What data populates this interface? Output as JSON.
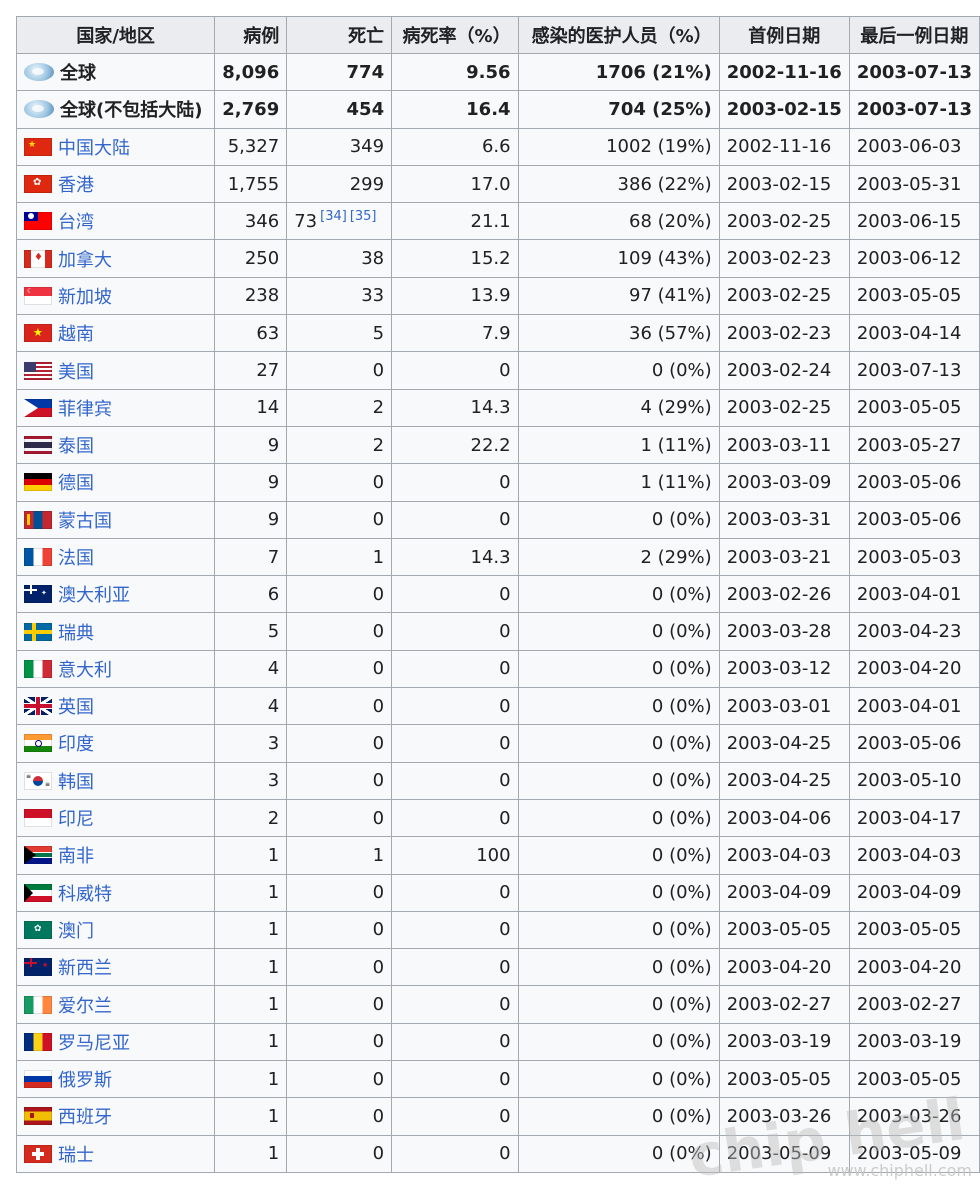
{
  "table": {
    "headers": [
      "国家/地区",
      "病例",
      "死亡",
      "病死率（%）",
      "感染的医护人员（%）",
      "首例日期",
      "最后一例日期"
    ],
    "rows": [
      {
        "name": "全球",
        "flag": "globe",
        "total": true,
        "cases": "8,096",
        "deaths": "774",
        "cfr": "9.56",
        "hcw": "1706 (21%)",
        "first": "2002-11-16",
        "last": "2003-07-13"
      },
      {
        "name": "全球(不包括大陆)",
        "flag": "globe",
        "total": true,
        "cases": "2,769",
        "deaths": "454",
        "cfr": "16.4",
        "hcw": "704 (25%)",
        "first": "2003-02-15",
        "last": "2003-07-13"
      },
      {
        "name": "中国大陆",
        "flag": "cn",
        "cases": "5,327",
        "deaths": "349",
        "cfr": "6.6",
        "hcw": "1002 (19%)",
        "first": "2002-11-16",
        "last": "2003-06-03"
      },
      {
        "name": "香港",
        "flag": "hk",
        "cases": "1,755",
        "deaths": "299",
        "cfr": "17.0",
        "hcw": "386 (22%)",
        "first": "2003-02-15",
        "last": "2003-05-31"
      },
      {
        "name": "台湾",
        "flag": "tw",
        "cases": "346",
        "deaths": "73",
        "deaths_refs": [
          "[34]",
          "[35]"
        ],
        "deaths_align": "left",
        "cfr": "21.1",
        "hcw": "68 (20%)",
        "first": "2003-02-25",
        "last": "2003-06-15"
      },
      {
        "name": "加拿大",
        "flag": "ca",
        "cases": "250",
        "deaths": "38",
        "cfr": "15.2",
        "hcw": "109 (43%)",
        "first": "2003-02-23",
        "last": "2003-06-12"
      },
      {
        "name": "新加坡",
        "flag": "sg",
        "cases": "238",
        "deaths": "33",
        "cfr": "13.9",
        "hcw": "97 (41%)",
        "first": "2003-02-25",
        "last": "2003-05-05"
      },
      {
        "name": "越南",
        "flag": "vn",
        "cases": "63",
        "deaths": "5",
        "cfr": "7.9",
        "hcw": "36 (57%)",
        "first": "2003-02-23",
        "last": "2003-04-14"
      },
      {
        "name": "美国",
        "flag": "us",
        "cases": "27",
        "deaths": "0",
        "cfr": "0",
        "hcw": "0 (0%)",
        "first": "2003-02-24",
        "last": "2003-07-13"
      },
      {
        "name": "菲律宾",
        "flag": "ph",
        "cases": "14",
        "deaths": "2",
        "cfr": "14.3",
        "hcw": "4 (29%)",
        "first": "2003-02-25",
        "last": "2003-05-05"
      },
      {
        "name": "泰国",
        "flag": "th",
        "cases": "9",
        "deaths": "2",
        "cfr": "22.2",
        "hcw": "1 (11%)",
        "first": "2003-03-11",
        "last": "2003-05-27"
      },
      {
        "name": "德国",
        "flag": "de",
        "cases": "9",
        "deaths": "0",
        "cfr": "0",
        "hcw": "1 (11%)",
        "first": "2003-03-09",
        "last": "2003-05-06"
      },
      {
        "name": "蒙古国",
        "flag": "mn",
        "cases": "9",
        "deaths": "0",
        "cfr": "0",
        "hcw": "0 (0%)",
        "first": "2003-03-31",
        "last": "2003-05-06"
      },
      {
        "name": "法国",
        "flag": "fr",
        "cases": "7",
        "deaths": "1",
        "cfr": "14.3",
        "hcw": "2 (29%)",
        "first": "2003-03-21",
        "last": "2003-05-03"
      },
      {
        "name": "澳大利亚",
        "flag": "au",
        "cases": "6",
        "deaths": "0",
        "cfr": "0",
        "hcw": "0 (0%)",
        "first": "2003-02-26",
        "last": "2003-04-01"
      },
      {
        "name": "瑞典",
        "flag": "se",
        "cases": "5",
        "deaths": "0",
        "cfr": "0",
        "hcw": "0 (0%)",
        "first": "2003-03-28",
        "last": "2003-04-23"
      },
      {
        "name": "意大利",
        "flag": "it",
        "cases": "4",
        "deaths": "0",
        "cfr": "0",
        "hcw": "0 (0%)",
        "first": "2003-03-12",
        "last": "2003-04-20"
      },
      {
        "name": "英国",
        "flag": "gb",
        "cases": "4",
        "deaths": "0",
        "cfr": "0",
        "hcw": "0 (0%)",
        "first": "2003-03-01",
        "last": "2003-04-01"
      },
      {
        "name": "印度",
        "flag": "in",
        "cases": "3",
        "deaths": "0",
        "cfr": "0",
        "hcw": "0 (0%)",
        "first": "2003-04-25",
        "last": "2003-05-06"
      },
      {
        "name": "韩国",
        "flag": "kr",
        "cases": "3",
        "deaths": "0",
        "cfr": "0",
        "hcw": "0 (0%)",
        "first": "2003-04-25",
        "last": "2003-05-10"
      },
      {
        "name": "印尼",
        "flag": "id",
        "cases": "2",
        "deaths": "0",
        "cfr": "0",
        "hcw": "0 (0%)",
        "first": "2003-04-06",
        "last": "2003-04-17"
      },
      {
        "name": "南非",
        "flag": "za",
        "cases": "1",
        "deaths": "1",
        "cfr": "100",
        "hcw": "0 (0%)",
        "first": "2003-04-03",
        "last": "2003-04-03"
      },
      {
        "name": "科威特",
        "flag": "kw",
        "cases": "1",
        "deaths": "0",
        "cfr": "0",
        "hcw": "0 (0%)",
        "first": "2003-04-09",
        "last": "2003-04-09"
      },
      {
        "name": "澳门",
        "flag": "mo",
        "cases": "1",
        "deaths": "0",
        "cfr": "0",
        "hcw": "0 (0%)",
        "first": "2003-05-05",
        "last": "2003-05-05"
      },
      {
        "name": "新西兰",
        "flag": "nz",
        "cases": "1",
        "deaths": "0",
        "cfr": "0",
        "hcw": "0 (0%)",
        "first": "2003-04-20",
        "last": "2003-04-20"
      },
      {
        "name": "爱尔兰",
        "flag": "ie",
        "cases": "1",
        "deaths": "0",
        "cfr": "0",
        "hcw": "0 (0%)",
        "first": "2003-02-27",
        "last": "2003-02-27"
      },
      {
        "name": "罗马尼亚",
        "flag": "ro",
        "cases": "1",
        "deaths": "0",
        "cfr": "0",
        "hcw": "0 (0%)",
        "first": "2003-03-19",
        "last": "2003-03-19"
      },
      {
        "name": "俄罗斯",
        "flag": "ru",
        "cases": "1",
        "deaths": "0",
        "cfr": "0",
        "hcw": "0 (0%)",
        "first": "2003-05-05",
        "last": "2003-05-05"
      },
      {
        "name": "西班牙",
        "flag": "es",
        "cases": "1",
        "deaths": "0",
        "cfr": "0",
        "hcw": "0 (0%)",
        "first": "2003-03-26",
        "last": "2003-03-26"
      },
      {
        "name": "瑞士",
        "flag": "ch",
        "cases": "1",
        "deaths": "0",
        "cfr": "0",
        "hcw": "0 (0%)",
        "first": "2003-05-09",
        "last": "2003-05-09"
      }
    ]
  },
  "watermark": {
    "text": "www.chiphell.com",
    "logo": "chip hell"
  }
}
